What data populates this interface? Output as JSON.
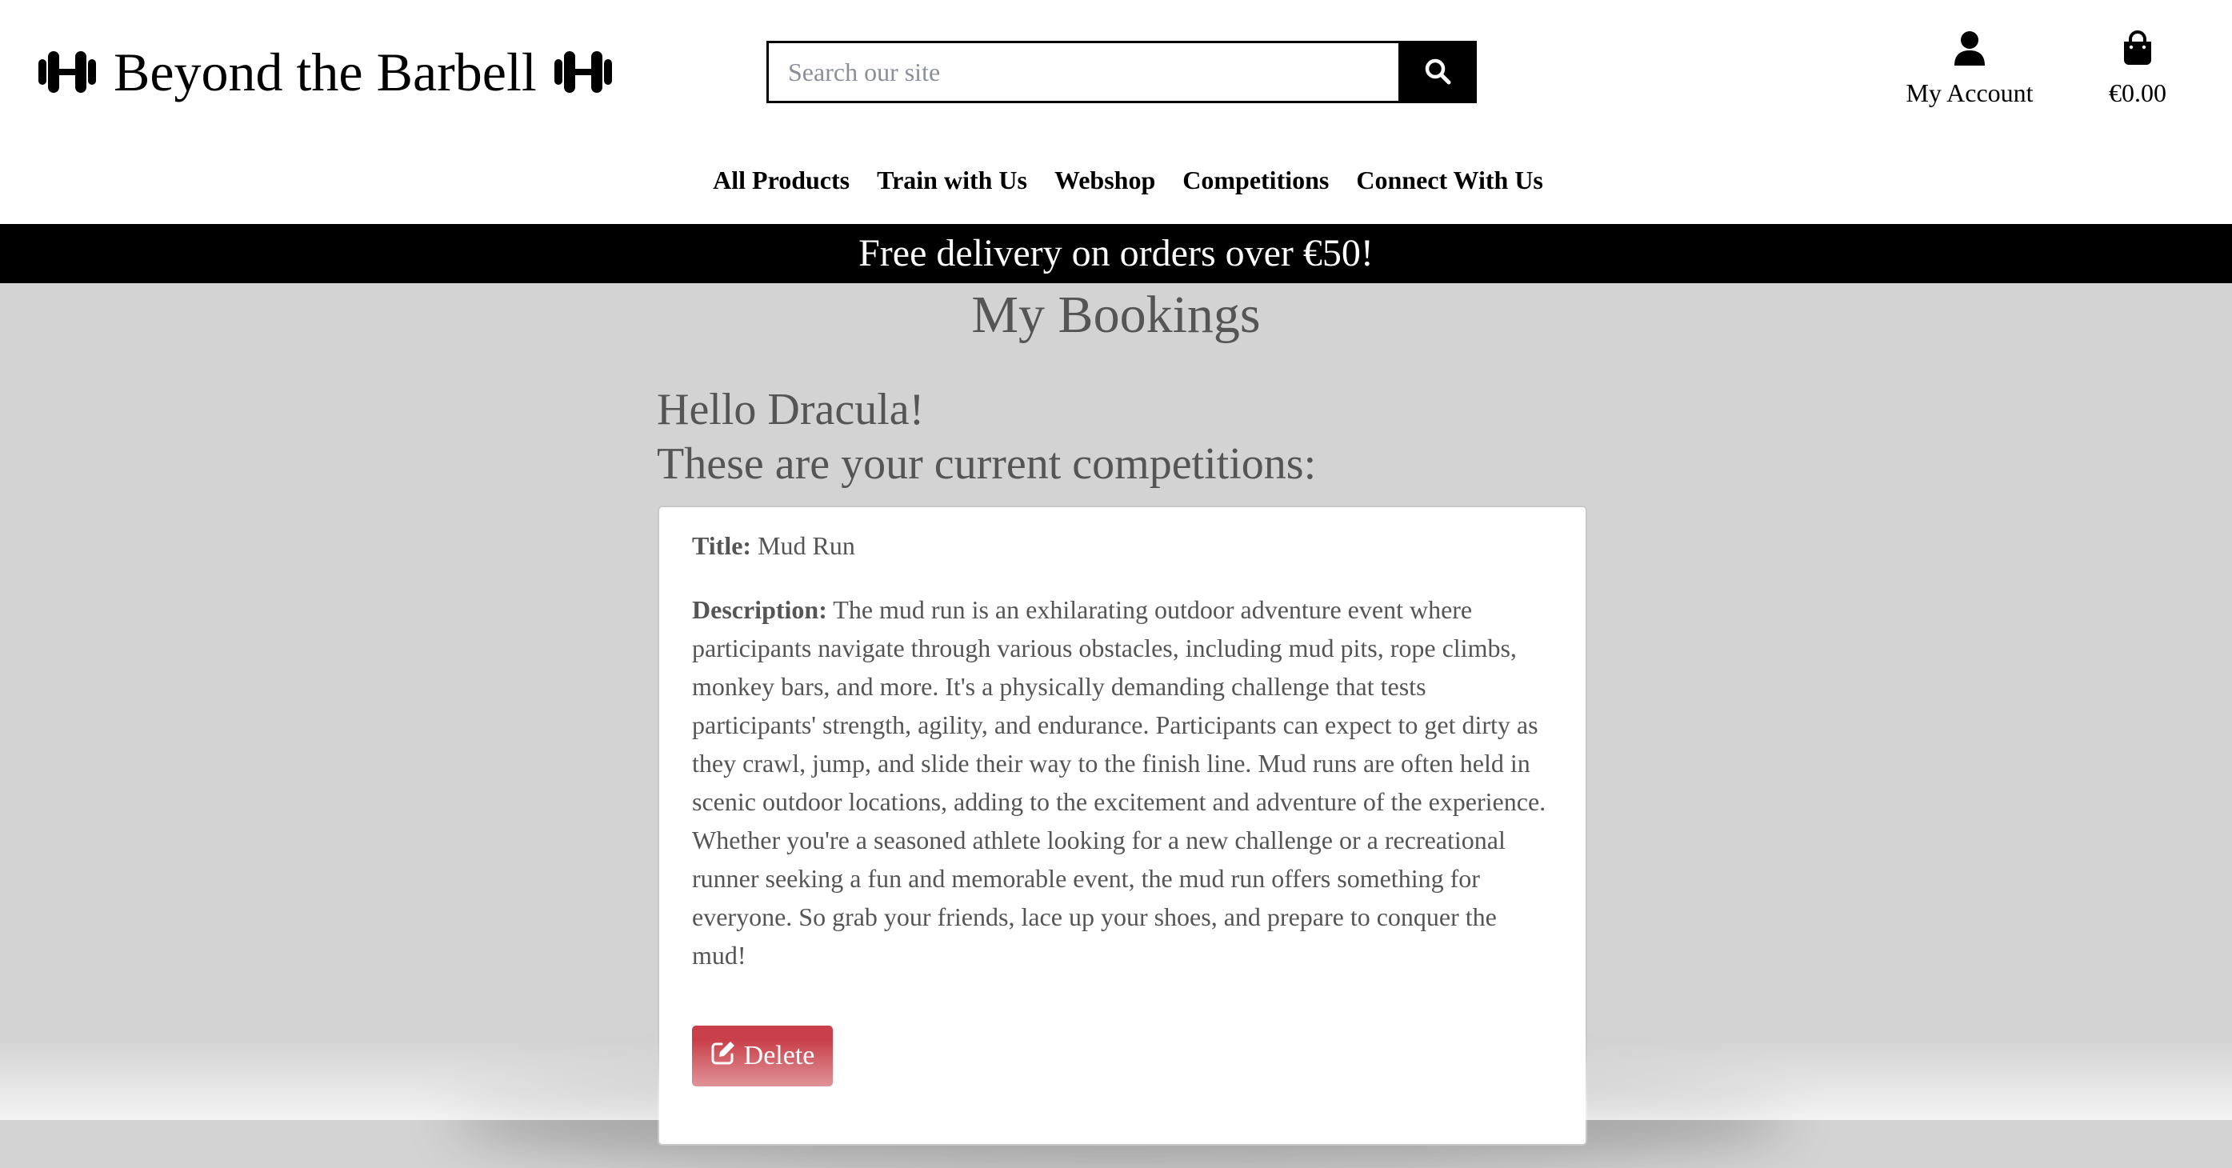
{
  "brand": {
    "name": "Beyond the Barbell",
    "icon": "dumbbell-icon"
  },
  "search": {
    "placeholder": "Search our site",
    "icon": "search-icon"
  },
  "account": {
    "label": "My Account",
    "icon": "user-icon"
  },
  "cart": {
    "total": "€0.00",
    "icon": "shopping-bag-icon"
  },
  "nav": {
    "items": [
      {
        "label": "All Products"
      },
      {
        "label": "Train with Us"
      },
      {
        "label": "Webshop"
      },
      {
        "label": "Competitions"
      },
      {
        "label": "Connect With Us"
      }
    ]
  },
  "banner": {
    "text": "Free delivery on orders over €50!"
  },
  "page": {
    "title": "My Bookings",
    "greeting": "Hello Dracula!",
    "subtitle": "These are your current competitions:"
  },
  "booking": {
    "title_label": "Title:",
    "title": "Mud Run",
    "description_label": "Description:",
    "description": "The mud run is an exhilarating outdoor adventure event where participants navigate through various obstacles, including mud pits, rope climbs, monkey bars, and more. It's a physically demanding challenge that tests participants' strength, agility, and endurance. Participants can expect to get dirty as they crawl, jump, and slide their way to the finish line. Mud runs are often held in scenic outdoor locations, adding to the excitement and adventure of the experience. Whether you're a seasoned athlete looking for a new challenge or a recreational runner seeking a fun and memorable event, the mud run offers something for everyone. So grab your friends, lace up your shoes, and prepare to conquer the mud!",
    "delete_label": "Delete",
    "delete_icon": "edit-icon"
  },
  "colors": {
    "header_bg": "#ffffff",
    "banner_bg": "#000000",
    "page_bg": "#d3d3d3",
    "delete_button": "#c9404a",
    "text_muted": "#555555"
  }
}
